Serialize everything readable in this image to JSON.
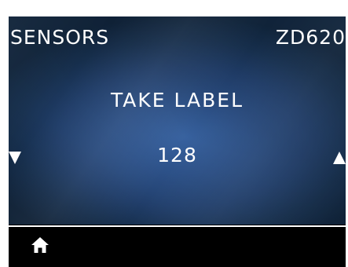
{
  "header": {
    "menu_title": "SENSORS",
    "model": "ZD620"
  },
  "main": {
    "message": "TAKE LABEL",
    "value": "128",
    "decrease_icon": "down-triangle-icon",
    "increase_icon": "up-triangle-icon"
  },
  "footer": {
    "home_icon": "home-icon"
  },
  "colors": {
    "text": "#ffffff",
    "background_center": "#3a66a6",
    "background_edge": "#10243b",
    "frame": "#000000"
  }
}
